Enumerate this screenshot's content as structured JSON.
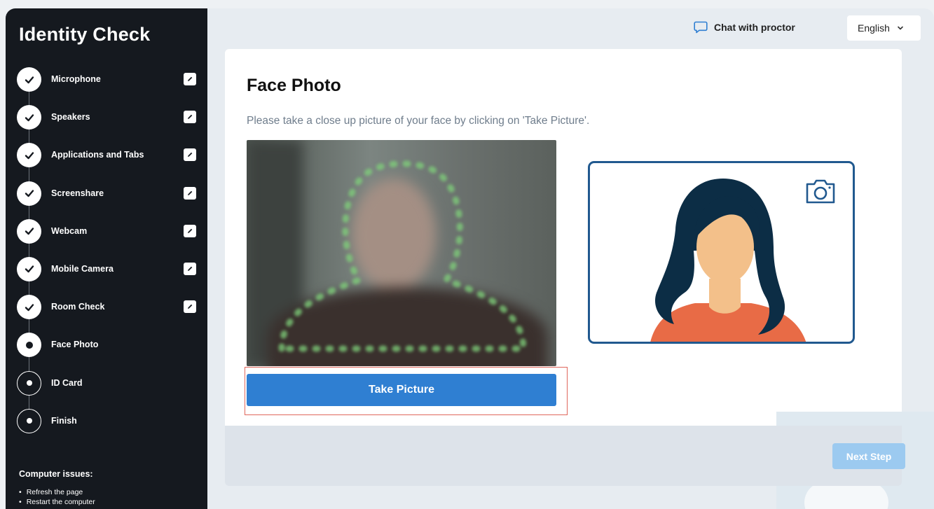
{
  "sidebar": {
    "title": "Identity Check",
    "steps": [
      {
        "label": "Microphone",
        "status": "done"
      },
      {
        "label": "Speakers",
        "status": "done"
      },
      {
        "label": "Applications and Tabs",
        "status": "done"
      },
      {
        "label": "Screenshare",
        "status": "done"
      },
      {
        "label": "Webcam",
        "status": "done"
      },
      {
        "label": "Mobile Camera",
        "status": "done"
      },
      {
        "label": "Room Check",
        "status": "done"
      },
      {
        "label": "Face Photo",
        "status": "current"
      },
      {
        "label": "ID Card",
        "status": "pending"
      },
      {
        "label": "Finish",
        "status": "pending"
      }
    ],
    "issues_title": "Computer issues:",
    "issues": [
      "Refresh the page",
      "Restart the computer"
    ]
  },
  "topbar": {
    "chat_label": "Chat with proctor",
    "language": "English"
  },
  "main": {
    "title": "Face Photo",
    "description": "Please take a close up picture of your face by clicking on 'Take Picture'.",
    "take_picture_label": "Take Picture"
  },
  "footer": {
    "next_label": "Next Step"
  },
  "colors": {
    "sidebar_bg": "#15191f",
    "primary_button": "#2f7fd2",
    "disabled_button": "#9ccaf0",
    "highlight_outline": "#e0675c",
    "frame_border": "#21598f"
  }
}
